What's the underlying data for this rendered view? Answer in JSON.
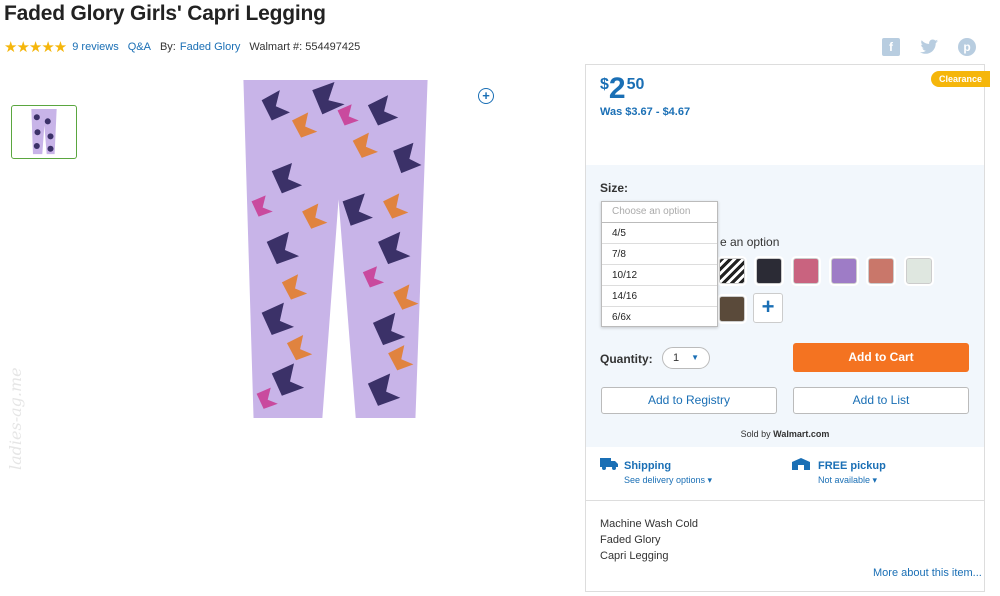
{
  "product": {
    "title": "Faded Glory Girls' Capri Legging",
    "rating_stars": "★★★★★",
    "reviews_link": "9 reviews",
    "qa_link": "Q&A",
    "by_prefix": "By:",
    "brand": "Faded Glory",
    "item_number_label": "Walmart #: 554497425"
  },
  "social": {
    "facebook": "f",
    "twitter": "t",
    "pinterest": "p"
  },
  "price": {
    "currency": "$",
    "dollars": "2",
    "cents": "50",
    "was": "Was $3.67 - $4.67",
    "badge": "Clearance"
  },
  "size": {
    "label": "Size:",
    "placeholder": "Choose an option",
    "options": [
      "4/5",
      "7/8",
      "10/12",
      "14/16",
      "6/6x"
    ]
  },
  "color": {
    "label_fragment": "e an option",
    "swatch_colors": [
      "#2b2b35",
      "#c9637f",
      "#9e7cc6",
      "#c9776a",
      "#dfe7e0",
      "#b5b5b5"
    ]
  },
  "quantity": {
    "label": "Quantity:",
    "value": "1"
  },
  "buttons": {
    "add_to_cart": "Add to Cart",
    "add_to_registry": "Add to Registry",
    "add_to_list": "Add to List"
  },
  "seller": {
    "prefix": "Sold by",
    "name": "Walmart.com"
  },
  "shipping": {
    "title": "Shipping",
    "sub": "See delivery options ▾",
    "pickup_title": "FREE pickup",
    "pickup_sub": "Not available ▾"
  },
  "description": {
    "lines": [
      "Machine Wash Cold",
      "Faded Glory",
      "Capri Legging"
    ],
    "more_link": "More about this item..."
  },
  "watermark": "ladies-ag.me",
  "colors": {
    "link": "#1a6fb5",
    "cart": "#f47321",
    "star": "#f5b60b",
    "legging": "#c8b4e8"
  }
}
